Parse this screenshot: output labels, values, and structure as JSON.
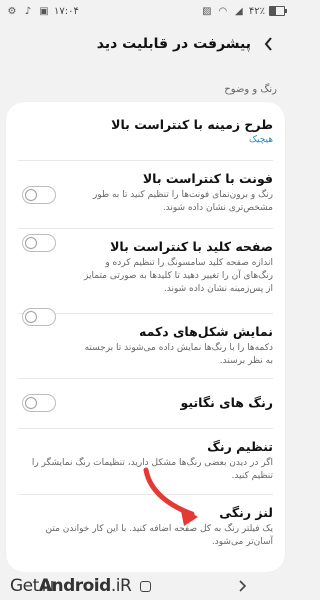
{
  "status": {
    "time": "۱۷:۰۴",
    "battery": "۴۲٪",
    "battery_level": 0.42
  },
  "header": {
    "title": "پیشرفت در قابلیت دید"
  },
  "section": {
    "label": "رنگ و وضوح"
  },
  "items": [
    {
      "title": "طرح زمینه با کنتراست بالا",
      "subtitle": "هیچیک"
    },
    {
      "title": "فونت با کنتراست بالا",
      "description": "رنگ و برون‌نمای فونت‌ها را تنظیم کنید تا به طور مشخص‌تری نشان داده شوند.",
      "toggle_on": false
    },
    {
      "title": "صفحه کلید با کنتراست بالا",
      "description": "اندازه صفحه کلید سامسونگ را تنظیم کرده و رنگ‌های آن را تغییر دهید تا کلیدها به صورتی متمایز از پس‌زمینه نشان داده شوند.",
      "toggle_on": false
    },
    {
      "title": "نمایش شکل‌های دکمه",
      "description": "دکمه‌ها را با رنگ‌ها نمایش داده می‌شوند تا برجسته به نظر برسند.",
      "toggle_on": false
    },
    {
      "title": "رنگ های نگاتیو",
      "toggle_on": false
    },
    {
      "title": "تنظیم رنگ",
      "description": "اگر در دیدن بعضی رنگ‌ها مشکل دارید، تنظیمات رنگ نمایشگر را تنظیم کنید."
    },
    {
      "title": "لنز رنگی",
      "description": "یک فیلتر رنگ به کل صفحه اضافه کنید. با این کار خواندن متن آسان‌تر می‌شود."
    }
  ],
  "watermark": {
    "prefix": "Get",
    "bold": "Android",
    "suffix": ".iR"
  },
  "colors": {
    "accent": "#2a86c7",
    "arrow": "#e53935"
  }
}
